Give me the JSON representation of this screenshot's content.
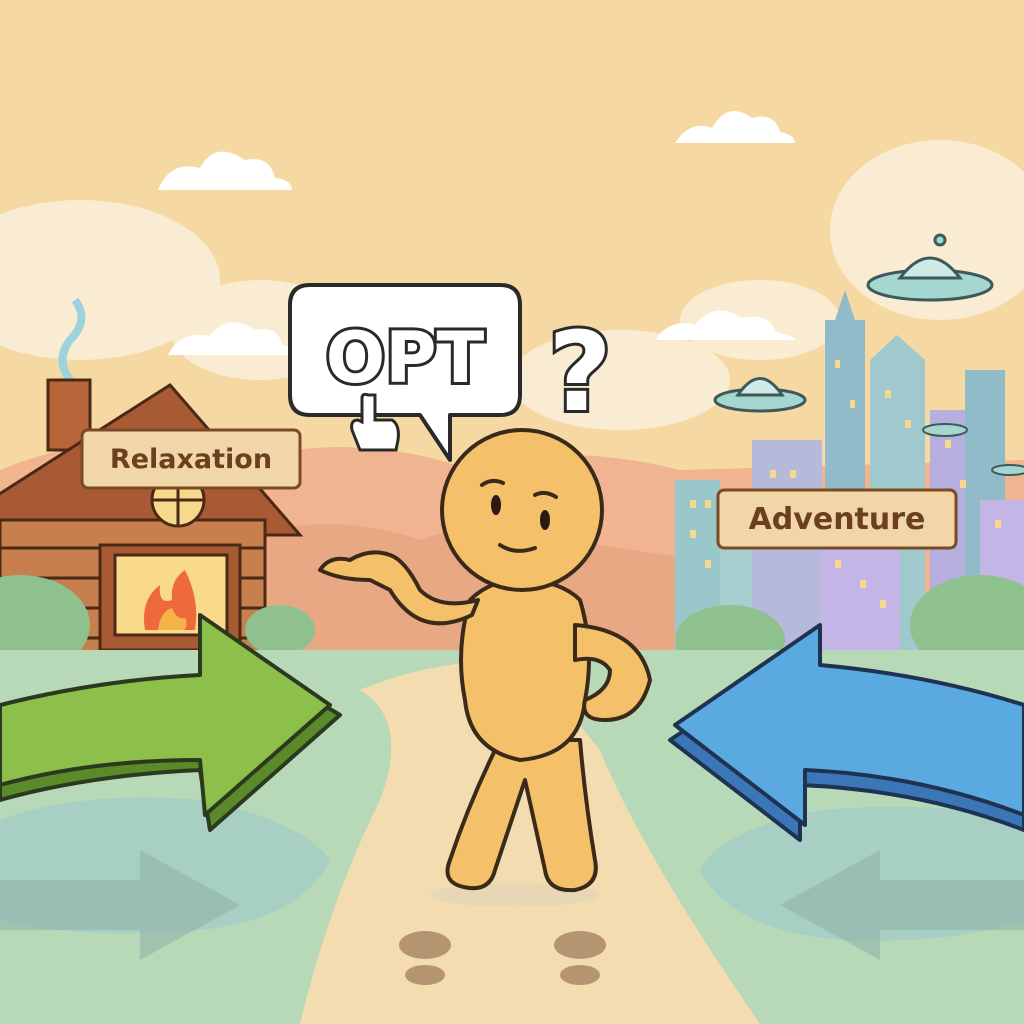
{
  "speech_bubble": {
    "text": "OPT",
    "pointer_icon": "pointing-hand-icon"
  },
  "question_mark": "?",
  "signs": {
    "left": "Relaxation",
    "right": "Adventure"
  },
  "colors": {
    "sky": "#f6d9a2",
    "left_arrow": "#8cc04a",
    "right_arrow": "#5aa9e0",
    "character": "#f4c06a",
    "path": "#f3dcb0",
    "grass": "#b8d9b8",
    "sign_wood": "#f1d6a8",
    "sign_text": "#6b3f1f"
  },
  "icons": {
    "left_scene": "log-cabin-icon",
    "right_scene": "city-skyline-icon",
    "fire": "fireplace-fire-icon",
    "ufo": "ufo-icon",
    "sun": "sun-icon",
    "footprints": "footprints-icon"
  }
}
